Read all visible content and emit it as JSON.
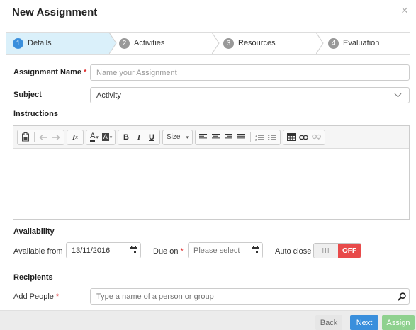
{
  "dialog": {
    "title": "New Assignment",
    "close_glyph": "×"
  },
  "wizard": {
    "steps": [
      {
        "num": "1",
        "label": "Details",
        "active": true
      },
      {
        "num": "2",
        "label": "Activities"
      },
      {
        "num": "3",
        "label": "Resources"
      },
      {
        "num": "4",
        "label": "Evaluation"
      }
    ]
  },
  "form": {
    "assignment_name": {
      "label": "Assignment Name",
      "required_mark": "*",
      "value": "",
      "placeholder": "Name your Assignment"
    },
    "subject": {
      "label": "Subject",
      "value": "Activity"
    },
    "instructions": {
      "label": "Instructions"
    }
  },
  "editor": {
    "toolbar": {
      "remove_format": "I",
      "remove_format_sub": "x",
      "text_color": "A",
      "bg_color": "A",
      "bold": "B",
      "italic": "I",
      "underline": "U",
      "size_label": "Size"
    },
    "content": ""
  },
  "availability": {
    "heading": "Availability",
    "available_from_label": "Available from",
    "available_from_value": "13/11/2016",
    "due_on_label": "Due on",
    "required_mark": "*",
    "due_on_value": "",
    "due_on_placeholder": "Please select",
    "auto_close_label": "Auto close",
    "toggle_knob": "III",
    "toggle_state": "OFF"
  },
  "recipients": {
    "heading": "Recipients",
    "add_people_label": "Add People",
    "required_mark": "*",
    "value": "",
    "placeholder": "Type a name of a person or group"
  },
  "buttons": {
    "back": "Back",
    "next": "Next",
    "assign": "Assign"
  },
  "colors": {
    "primary": "#3a8fdc",
    "success": "#8fd18f",
    "danger": "#e84a4a",
    "step_active_bg": "#daf0fa"
  }
}
